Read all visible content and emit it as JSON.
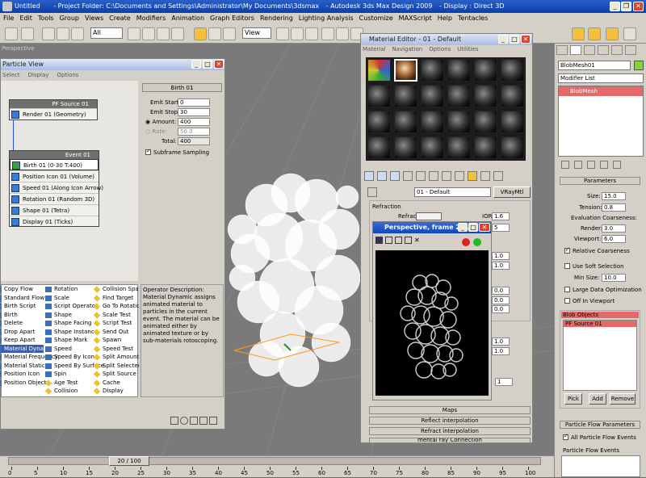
{
  "window": {
    "title_left": "Untitled",
    "title_folder": "- Project Folder: C:\\Documents and Settings\\Administrator\\My Documents\\3dsmax",
    "title_app": "- Autodesk 3ds Max Design 2009",
    "title_display": "- Display : Direct 3D"
  },
  "menu": [
    "File",
    "Edit",
    "Tools",
    "Group",
    "Views",
    "Create",
    "Modifiers",
    "Animation",
    "Graph Editors",
    "Rendering",
    "Lighting Analysis",
    "Customize",
    "MAXScript",
    "Help",
    "Tentacles"
  ],
  "toolbar": {
    "filter": "All",
    "coord": "View",
    "selection_set": "Create Selection Set"
  },
  "viewport": {
    "label": "Perspective"
  },
  "particle_view": {
    "title": "Particle View",
    "menu": [
      "Select",
      "Display",
      "Options"
    ],
    "source": {
      "header": "PF Source 01",
      "row": "Render 01 (Geometry)"
    },
    "event": {
      "header": "Event 01",
      "rows": [
        "Birth 01 (0-30 T:400)",
        "Position Icon 01 (Volume)",
        "Speed 01 (Along Icon Arrow)",
        "Rotation 01 (Random 3D)",
        "Shape 01 (Tetra)",
        "Display 01 (Ticks)"
      ]
    },
    "birth": {
      "title": "Birth 01",
      "emit_start_label": "Emit Start:",
      "emit_start": "0",
      "emit_stop_label": "Emit Stop:",
      "emit_stop": "30",
      "amount_label": "Amount:",
      "amount": "400",
      "rate_label": "Rate:",
      "rate": "50.0",
      "total_label": "Total:",
      "total": "400",
      "subframe": "Subframe Sampling"
    },
    "ops_col1": [
      "Copy Flow",
      "Standard Flow",
      "Birth Script",
      "Birth",
      "Delete",
      "Drop Apart",
      "Keep Apart",
      "Material Dynamic",
      "Material Frequency",
      "Material Static",
      "Position Icon",
      "Position Object"
    ],
    "ops_col2": [
      "Rotation",
      "Scale",
      "Script Operator",
      "Shape",
      "Shape Facing",
      "Shape Instance",
      "Shape Mark",
      "Speed",
      "Speed By Icon",
      "Speed By Surface",
      "Spin",
      "Age Test",
      "Collision"
    ],
    "ops_col3": [
      "Collision Spawn",
      "Find Target",
      "Go To Rotation",
      "Scale Test",
      "Script Test",
      "Send Out",
      "Spawn",
      "Speed Test",
      "Split Amount",
      "Split Selected",
      "Split Source",
      "Cache",
      "Display"
    ],
    "description": "Operator Description:",
    "description_text": "Material Dynamic assigns animated material to particles in the current event. The material can be animated either by animated texture or by sub-materials rotoscoping."
  },
  "material_editor": {
    "title": "Material Editor - 01 - Default",
    "menu": [
      "Material",
      "Navigation",
      "Options",
      "Utilities"
    ],
    "mat_name": "01 - Default",
    "mat_type": "VRayMtl",
    "refraction": "Refraction",
    "refract": "Refract",
    "ior_label": "IOR",
    "ior": "1.6",
    "v1": "5",
    "v2": "1.0",
    "v3": "1.0",
    "v4": "0.0",
    "v5": "0.0",
    "v6": "0.0",
    "v7": "1.0",
    "v8": "1.0",
    "v9": "1",
    "rollouts": [
      "Maps",
      "Reflect interpolation",
      "Refract interpolation",
      "mental ray Connection"
    ]
  },
  "render_window": {
    "title": "Perspective, frame 20..."
  },
  "command_panel": {
    "object_name": "BlobMesh01",
    "modifier_list": "Modifier List",
    "stack_item": "BlobMesh",
    "parameters": "Parameters",
    "size_label": "Size:",
    "size": "15.0",
    "tension_label": "Tension:",
    "tension": "0.8",
    "eval": "Evaluation Coarseness:",
    "render_label": "Render:",
    "render": "3.0",
    "viewport_label": "Viewport:",
    "viewport": "6.0",
    "relative": "Relative Coarseness",
    "use_soft": "Use Soft Selection",
    "min_size_label": "Min Size:",
    "min_size": "10.0",
    "large_data": "Large Data Optimization",
    "off_in_viewport": "Off In Viewport",
    "blob_objects": "Blob Objects",
    "blob_item": "PF Source 01",
    "pick": "Pick",
    "add": "Add",
    "remove": "Remove",
    "pf_params": "Particle Flow Parameters",
    "all_events": "All Particle Flow Events",
    "pf_events": "Particle Flow Events"
  },
  "timeline": {
    "slider": "20 / 100",
    "ticks": [
      "0",
      "5",
      "10",
      "15",
      "20",
      "25",
      "30",
      "35",
      "40",
      "45",
      "50",
      "55",
      "60",
      "65",
      "70",
      "75",
      "80",
      "85",
      "90",
      "95",
      "100"
    ]
  },
  "colors": {
    "title_blue": "#0b3fa8",
    "ui_gray": "#d4d0c8",
    "highlight_blue": "#3a5fb0",
    "stack_red": "#e46a6a",
    "accent_yellow": "#f5c03c"
  }
}
